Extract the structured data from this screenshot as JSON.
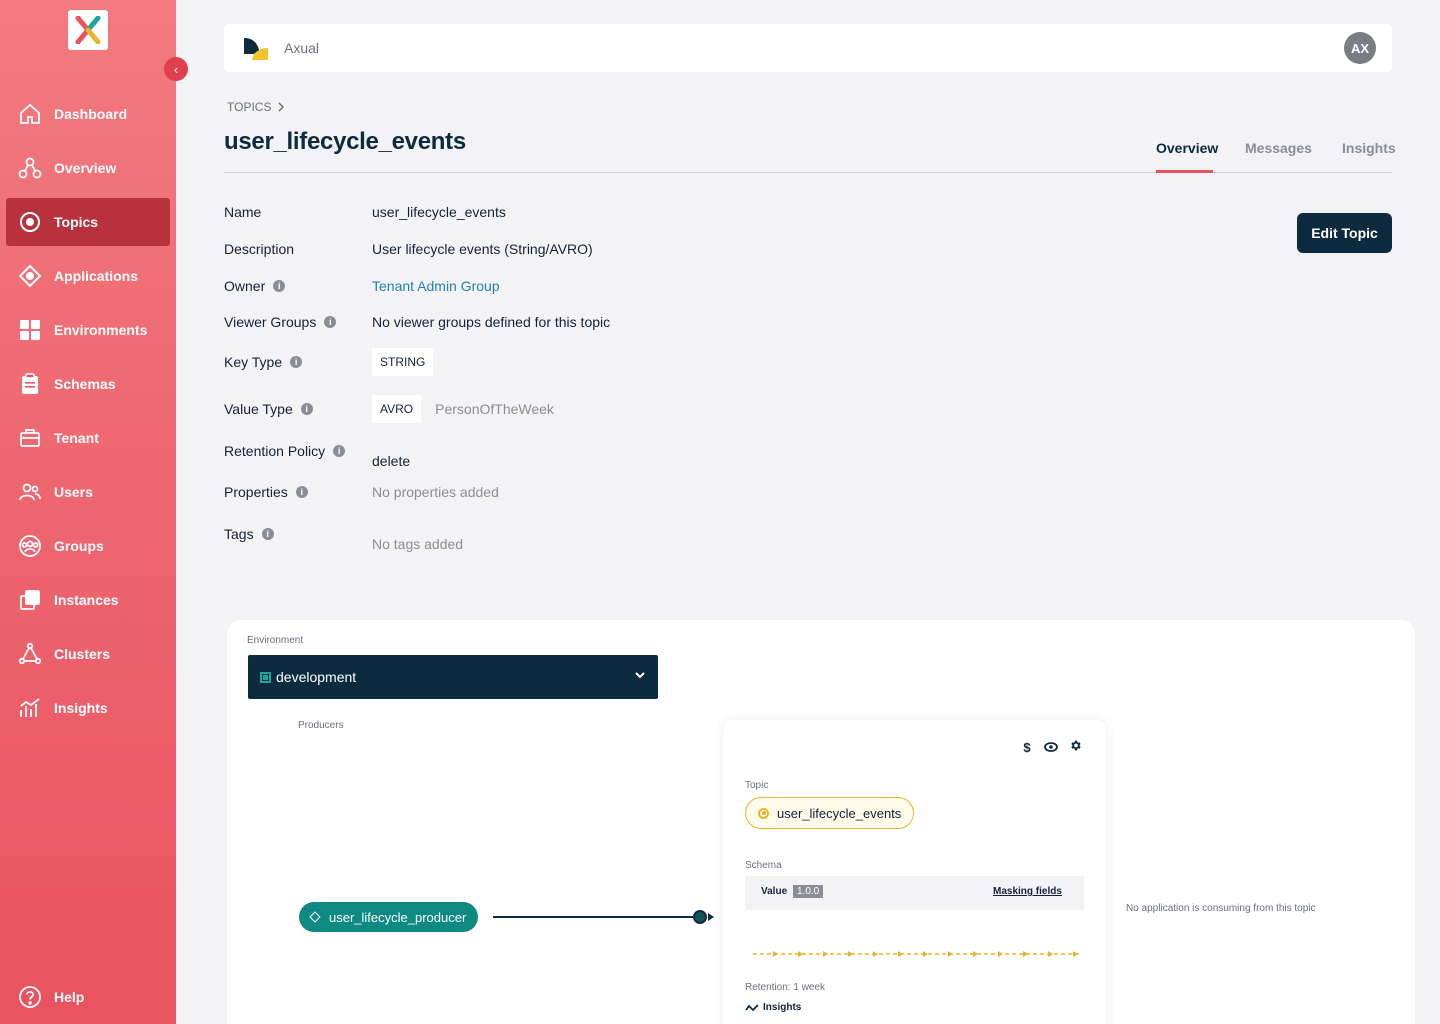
{
  "sidebar": {
    "items": [
      {
        "label": "Dashboard",
        "icon": "home-icon"
      },
      {
        "label": "Overview",
        "icon": "overview-icon"
      },
      {
        "label": "Topics",
        "icon": "topics-icon",
        "active": true
      },
      {
        "label": "Applications",
        "icon": "applications-icon"
      },
      {
        "label": "Environments",
        "icon": "environments-icon"
      },
      {
        "label": "Schemas",
        "icon": "schemas-icon"
      },
      {
        "label": "Tenant",
        "icon": "tenant-icon"
      },
      {
        "label": "Users",
        "icon": "users-icon"
      },
      {
        "label": "Groups",
        "icon": "groups-icon"
      },
      {
        "label": "Instances",
        "icon": "instances-icon"
      },
      {
        "label": "Clusters",
        "icon": "clusters-icon"
      },
      {
        "label": "Insights",
        "icon": "insights-icon"
      }
    ],
    "help_label": "Help"
  },
  "topbar": {
    "brand": "Axual",
    "avatar_initials": "AX"
  },
  "header": {
    "breadcrumb": "TOPICS",
    "title": "user_lifecycle_events",
    "tabs": [
      {
        "label": "Overview",
        "active": true
      },
      {
        "label": "Messages"
      },
      {
        "label": "Insights"
      }
    ],
    "edit_button": "Edit Topic"
  },
  "details": {
    "name_label": "Name",
    "name_value": "user_lifecycle_events",
    "description_label": "Description",
    "description_value": "User lifecycle events (String/AVRO)",
    "owner_label": "Owner",
    "owner_value": "Tenant Admin Group",
    "viewer_groups_label": "Viewer Groups",
    "viewer_groups_value": "No viewer groups defined for this topic",
    "key_type_label": "Key Type",
    "key_type_value": "STRING",
    "value_type_label": "Value Type",
    "value_type_value": "AVRO",
    "value_type_schema": "PersonOfTheWeek",
    "retention_label": "Retention Policy",
    "retention_value": "delete",
    "properties_label": "Properties",
    "properties_value": "No properties added",
    "tags_label": "Tags",
    "tags_value": "No tags added"
  },
  "graph": {
    "environment_label": "Environment",
    "environment_value": "development",
    "producers_label": "Producers",
    "producer_name": "user_lifecycle_producer",
    "card": {
      "topic_label": "Topic",
      "topic_name": "user_lifecycle_events",
      "schema_label": "Schema",
      "schema_value_label": "Value",
      "schema_version": "1.0.0",
      "masking_link": "Masking fields",
      "retention": "Retention: 1 week",
      "insights_link": "Insights"
    },
    "no_consumer_text": "No application is consuming from this topic"
  },
  "colors": {
    "accent": "#e9525f",
    "navy": "#0d2b3e",
    "teal": "#0f8a83",
    "topic_yellow": "#e5b62b"
  }
}
